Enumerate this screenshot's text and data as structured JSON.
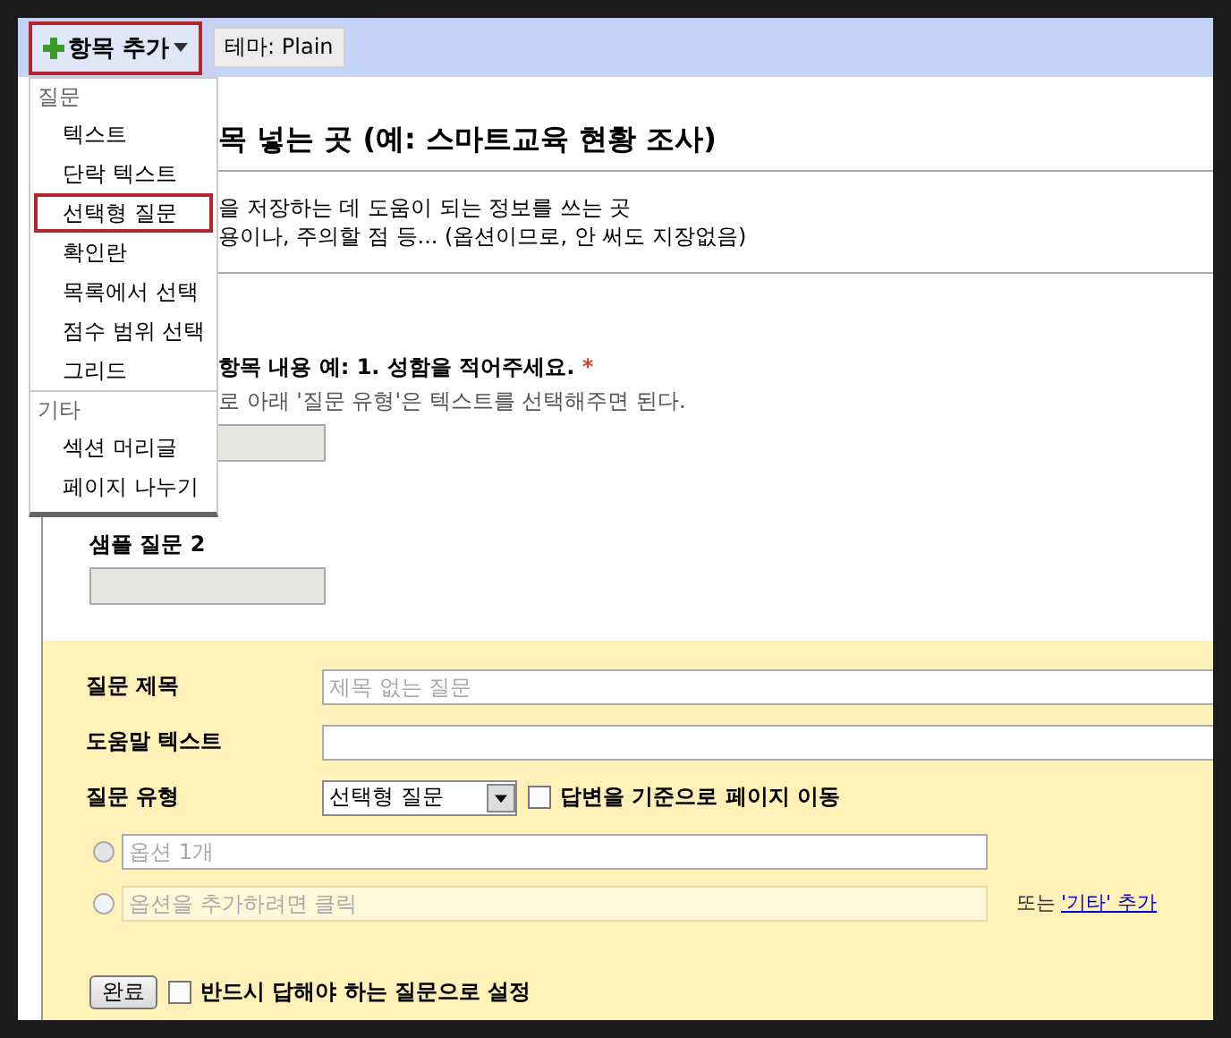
{
  "toolbar": {
    "add_button": {
      "label": "항목 추가",
      "highlighted": true
    },
    "theme_button": {
      "label": "테마: Plain"
    }
  },
  "add_menu": {
    "sections": [
      {
        "header": "질문",
        "items": [
          {
            "label": "텍스트",
            "highlighted": false
          },
          {
            "label": "단락 텍스트",
            "highlighted": false
          },
          {
            "label": "선택형 질문",
            "highlighted": true
          },
          {
            "label": "확인란",
            "highlighted": false
          },
          {
            "label": "목록에서 선택",
            "highlighted": false
          },
          {
            "label": "점수 범위 선택",
            "highlighted": false
          },
          {
            "label": "그리드",
            "highlighted": false
          }
        ]
      },
      {
        "header": "기타",
        "items": [
          {
            "label": "섹션 머리글",
            "highlighted": false
          },
          {
            "label": "페이지 나누기",
            "highlighted": false
          }
        ]
      }
    ]
  },
  "form": {
    "title": "목 넣는 곳 (예: 스마트교육 현황 조사)",
    "description_lines": [
      "을 저장하는 데 도움이 되는 정보를 쓰는 곳",
      "용이나, 주의할 점 등... (옵션이므로, 안 써도 지장없음)"
    ],
    "questions": [
      {
        "title": "항목 내용 예: 1. 성함을 적어주세요.",
        "required_mark": "*",
        "help": "로 아래 '질문 유형'은 텍스트를 선택해주면 된다."
      },
      {
        "title": "샘플 질문 2"
      }
    ]
  },
  "editor": {
    "fields": [
      {
        "label": "질문 제목",
        "placeholder": "제목 없는 질문"
      },
      {
        "label": "도움말 텍스트"
      }
    ],
    "type_row": {
      "label": "질문 유형",
      "value": "선택형 질문",
      "checkbox": {
        "label": "답변을 기준으로 페이지 이동",
        "checked": false
      }
    },
    "options": [
      {
        "kind": "option",
        "placeholder": "옵션 1개",
        "selected": false
      },
      {
        "kind": "add",
        "placeholder": "옵션을 추가하려면 클릭",
        "selected": false
      }
    ],
    "other_prefix": "또는",
    "other_link": "'기타' 추가",
    "done_button": "완료",
    "required_checkbox": {
      "label": "반드시 답해야 하는 질문으로 설정",
      "checked": false
    }
  }
}
